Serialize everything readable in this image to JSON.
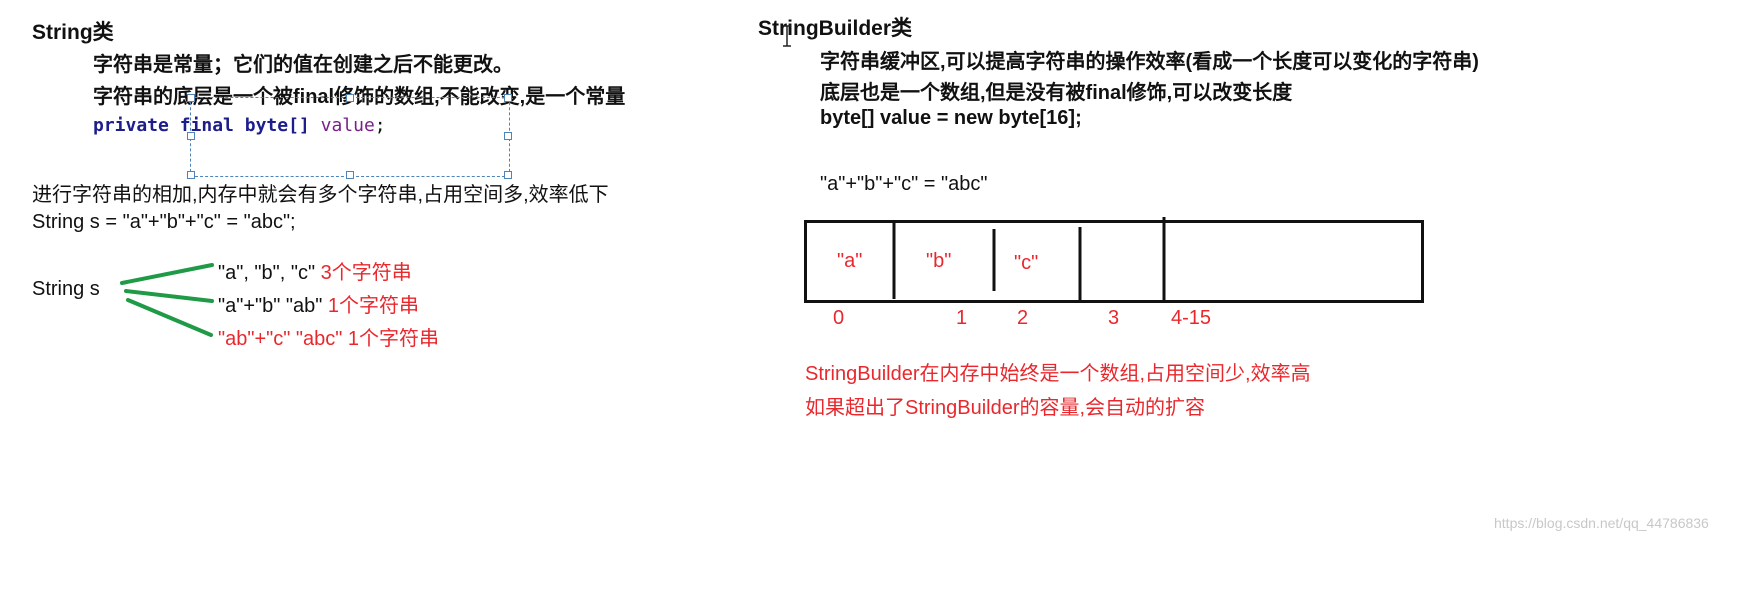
{
  "left": {
    "title": "String类",
    "line1": "字符串是常量；它们的值在创建之后不能更改。",
    "line2": "字符串的底层是一个被final修饰的数组,不能改变,是一个常量",
    "code": {
      "kw1": "private",
      "kw2": "final",
      "kw3": "byte[]",
      "ident": "value",
      "end": ";"
    },
    "concat_note": "进行字符串的相加,内存中就会有多个字符串,占用空间多,效率低下",
    "example": "String s = \"a\"+\"b\"+\"c\" = \"abc\";",
    "string_s": "String s",
    "branches": [
      {
        "black": "\"a\", \"b\", \"c\"",
        "red": "3个字符串"
      },
      {
        "black": "\"a\"+\"b\"  \"ab\"",
        "red": "1个字符串"
      },
      {
        "black": "",
        "red": "\"ab\"+\"c\" \"abc\" 1个字符串"
      }
    ]
  },
  "right": {
    "title": "StringBuilder类",
    "line1": "字符串缓冲区,可以提高字符串的操作效率(看成一个长度可以变化的字符串)",
    "line2": "底层也是一个数组,但是没有被final修饰,可以改变长度",
    "line3": "byte[] value = new byte[16];",
    "concat": "\"a\"+\"b\"+\"c\" = \"abc\"",
    "cells": [
      "\"a\"",
      "\"b\"",
      "\"c\""
    ],
    "indices": [
      "0",
      "1",
      "2",
      "3",
      "4-15"
    ],
    "note1": "StringBuilder在内存中始终是一个数组,占用空间少,效率高",
    "note2": "如果超出了StringBuilder的容量,会自动的扩容"
  },
  "watermark": "https://blog.csdn.net/qq_44786836",
  "colors": {
    "red": "#e8282d",
    "green": "#1f9a46",
    "keyword": "#1d1d8c",
    "identifier": "#7a1f8a"
  }
}
